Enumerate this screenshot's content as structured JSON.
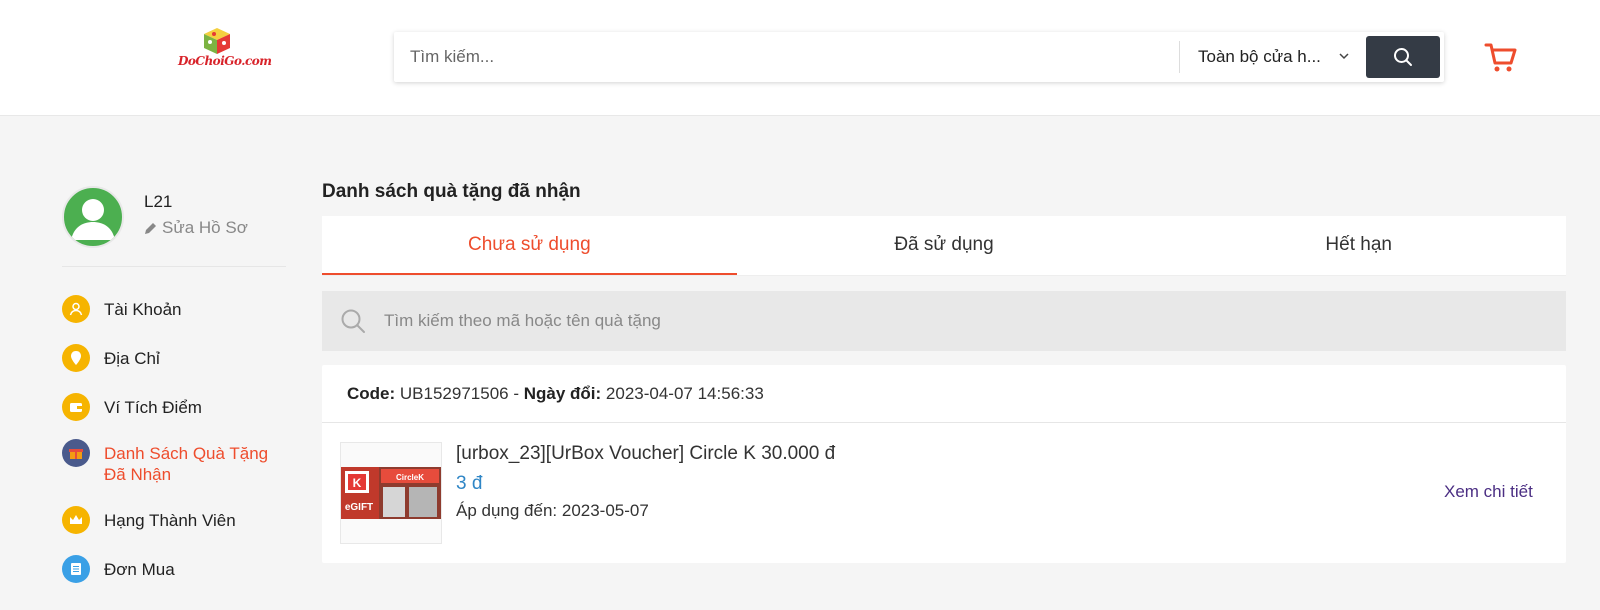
{
  "header": {
    "logo_text": "DoChoiGo.com",
    "search_placeholder": "Tìm kiếm...",
    "store_select": "Toàn bộ cửa h...",
    "colors": {
      "dark_button": "#343b45",
      "accent": "#ee4d2d"
    }
  },
  "profile": {
    "username": "L21",
    "edit_label": "Sửa Hồ Sơ"
  },
  "sidebar": {
    "items": [
      {
        "label": "Tài Khoản",
        "icon": "user-icon",
        "color": "#f6b400"
      },
      {
        "label": "Địa Chỉ",
        "icon": "location-pin-icon",
        "color": "#f6b400"
      },
      {
        "label": "Ví Tích Điểm",
        "icon": "wallet-icon",
        "color": "#f6b400"
      },
      {
        "label": "Danh Sách Quà Tặng Đã Nhận",
        "icon": "gift-icon",
        "color": "#4a5a8c",
        "active": true
      },
      {
        "label": "Hạng Thành Viên",
        "icon": "crown-icon",
        "color": "#f6b400"
      },
      {
        "label": "Đơn Mua",
        "icon": "order-list-icon",
        "color": "#3aa0e6"
      }
    ]
  },
  "main": {
    "title": "Danh sách quà tặng đã nhận",
    "tabs": [
      {
        "label": "Chưa sử dụng",
        "active": true
      },
      {
        "label": "Đã sử dụng"
      },
      {
        "label": "Hết hạn"
      }
    ],
    "search_placeholder": "Tìm kiếm theo mã hoặc tên quà tặng",
    "gift": {
      "code_label": "Code:",
      "code_value": "UB152971506",
      "separator": " - ",
      "date_label": "Ngày đổi:",
      "date_value": "2023-04-07 14:56:33",
      "name": "[urbox_23][UrBox Voucher] Circle K 30.000 đ",
      "price": "3 đ",
      "expire": "Áp dụng đến: 2023-05-07",
      "detail_link": "Xem chi tiết",
      "thumb_badge_k": "K",
      "thumb_badge_egift": "eGIFT",
      "thumb_sign": "CircleK"
    }
  }
}
